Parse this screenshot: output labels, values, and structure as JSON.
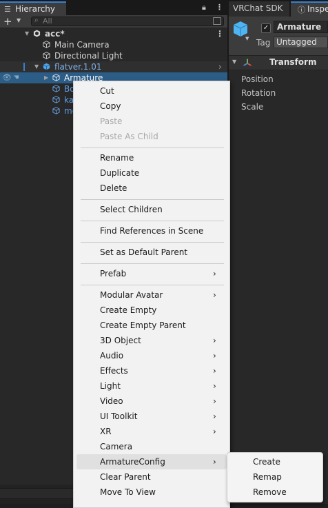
{
  "hierarchy": {
    "tab_label": "Hierarchy",
    "search_placeholder": "All",
    "add_label": "+",
    "rows": [
      {
        "label": "acc*"
      },
      {
        "label": "Main Camera"
      },
      {
        "label": "Directional Light"
      },
      {
        "label": "flatver.1.01"
      },
      {
        "label": "Armature"
      },
      {
        "label": "Bo"
      },
      {
        "label": "ka"
      },
      {
        "label": "mo"
      }
    ]
  },
  "right_panel": {
    "tab_vrchat": "VRChat SDK",
    "tab_inspector": "Inspe",
    "object_name": "Armature",
    "object_enabled": true,
    "tag_label": "Tag",
    "tag_value": "Untagged",
    "component_title": "Transform",
    "props": [
      "Position",
      "Rotation",
      "Scale"
    ]
  },
  "context_menu": {
    "items": [
      {
        "label": "Cut",
        "disabled": false,
        "submenu": false
      },
      {
        "label": "Copy",
        "disabled": false,
        "submenu": false
      },
      {
        "label": "Paste",
        "disabled": true,
        "submenu": false
      },
      {
        "label": "Paste As Child",
        "disabled": true,
        "submenu": false
      },
      {
        "label": "Rename",
        "disabled": false,
        "submenu": false
      },
      {
        "label": "Duplicate",
        "disabled": false,
        "submenu": false
      },
      {
        "label": "Delete",
        "disabled": false,
        "submenu": false
      },
      {
        "label": "Select Children",
        "disabled": false,
        "submenu": false
      },
      {
        "label": "Find References in Scene",
        "disabled": false,
        "submenu": false
      },
      {
        "label": "Set as Default Parent",
        "disabled": false,
        "submenu": false
      },
      {
        "label": "Prefab",
        "disabled": false,
        "submenu": true
      },
      {
        "label": "Modular Avatar",
        "disabled": false,
        "submenu": true
      },
      {
        "label": "Create Empty",
        "disabled": false,
        "submenu": false
      },
      {
        "label": "Create Empty Parent",
        "disabled": false,
        "submenu": false
      },
      {
        "label": "3D Object",
        "disabled": false,
        "submenu": true
      },
      {
        "label": "Audio",
        "disabled": false,
        "submenu": true
      },
      {
        "label": "Effects",
        "disabled": false,
        "submenu": true
      },
      {
        "label": "Light",
        "disabled": false,
        "submenu": true
      },
      {
        "label": "Video",
        "disabled": false,
        "submenu": true
      },
      {
        "label": "UI Toolkit",
        "disabled": false,
        "submenu": true
      },
      {
        "label": "XR",
        "disabled": false,
        "submenu": true
      },
      {
        "label": "Camera",
        "disabled": false,
        "submenu": false
      },
      {
        "label": "ArmatureConfig",
        "disabled": false,
        "submenu": true
      },
      {
        "label": "Clear Parent",
        "disabled": false,
        "submenu": false
      },
      {
        "label": "Move To View",
        "disabled": false,
        "submenu": false
      }
    ],
    "submenu_arrow": "›",
    "armatureconfig_submenu": [
      "Create",
      "Remap",
      "Remove"
    ]
  },
  "colors": {
    "selection": "#2c5d87",
    "accent_tab": "#3a7fd0",
    "prefab_blue": "#5a9ee6",
    "menu_bg": "#f2f2f2"
  }
}
